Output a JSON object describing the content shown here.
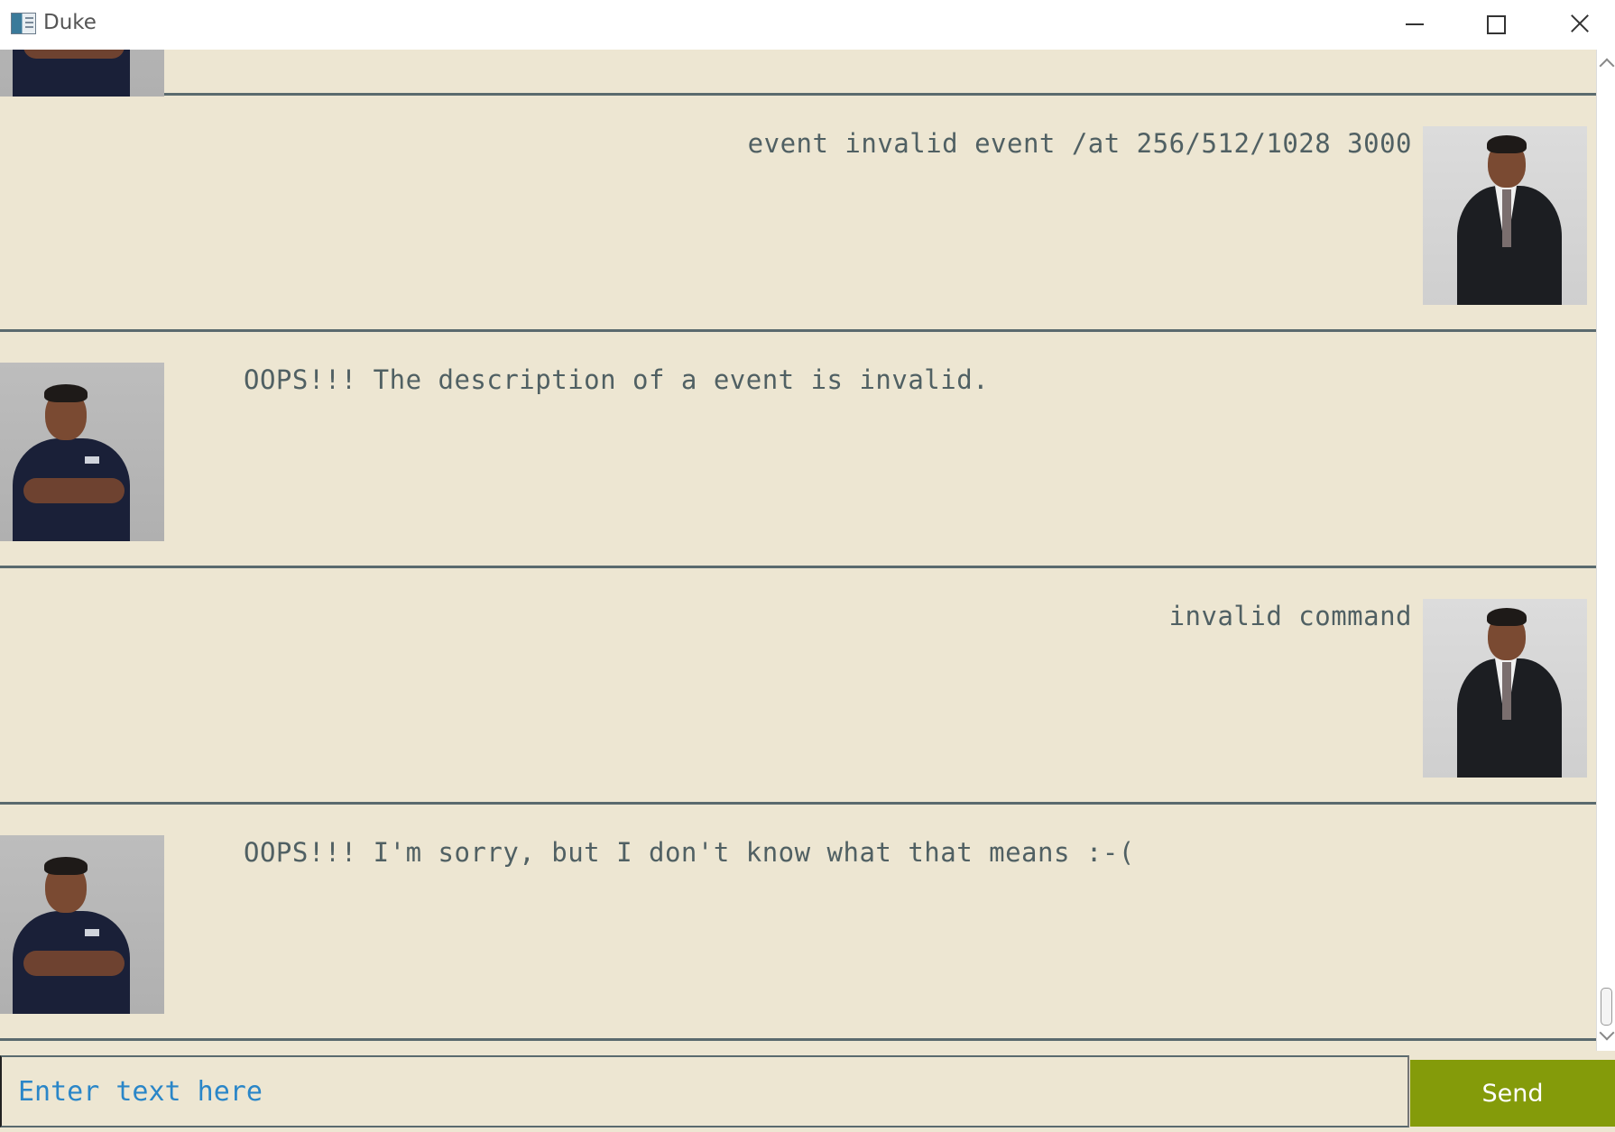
{
  "window": {
    "title": "Duke"
  },
  "messages": [
    {
      "sender": "bot",
      "text": ""
    },
    {
      "sender": "user",
      "text": "event invalid event /at 256/512/1028 3000"
    },
    {
      "sender": "bot",
      "text": "OOPS!!! The description of a event is invalid."
    },
    {
      "sender": "user",
      "text": "invalid command"
    },
    {
      "sender": "bot",
      "text": "OOPS!!! I'm sorry, but I don't know what that means :-("
    }
  ],
  "input": {
    "placeholder": "Enter text here",
    "value": ""
  },
  "send_button": {
    "label": "Send"
  },
  "colors": {
    "background": "#ede6d2",
    "text": "#506063",
    "divider": "#5a6a6e",
    "send_button": "#849b0a",
    "placeholder": "#2a86c8"
  },
  "icons": [
    "app-icon",
    "minimize-icon",
    "maximize-icon",
    "close-icon",
    "scroll-up-icon",
    "scroll-down-icon"
  ]
}
